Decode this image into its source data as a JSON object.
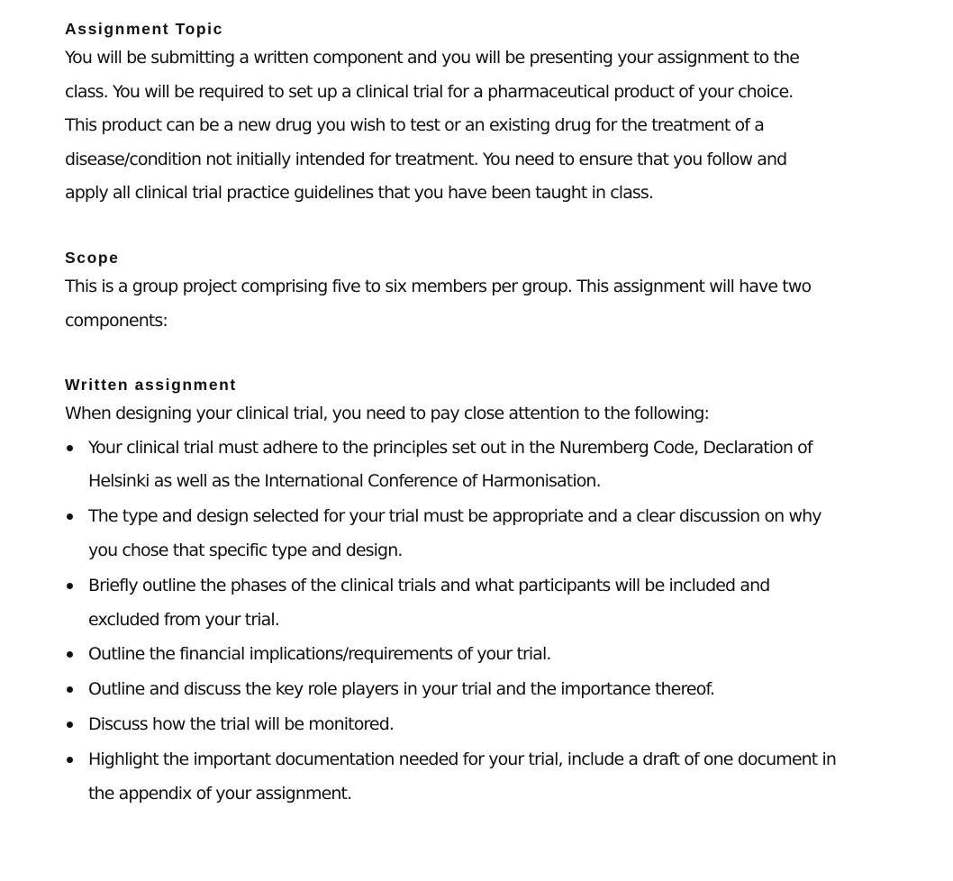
{
  "sections": {
    "topic": {
      "heading": "Assignment Topic",
      "lines": [
        "You will be submitting a written component and you will be presenting your assignment to the",
        "class. You will be required to set up a clinical trial for a pharmaceutical product of your choice.",
        "This product can be a new drug you wish to test or an existing drug for the treatment of a",
        "disease/condition not initially intended for treatment. You need to ensure that you follow and",
        "apply all clinical trial practice guidelines that you have been taught in class."
      ]
    },
    "scope": {
      "heading": "Scope",
      "lines": [
        "This is a group project comprising five to six members per group. This assignment will have two",
        "components:"
      ]
    },
    "written": {
      "heading": "Written assignment",
      "intro": "When designing your clinical trial, you need to pay close attention to the following:",
      "bullets": [
        {
          "lines": [
            "Your clinical trial must adhere to the principles set out in the Nuremberg Code, Declaration of",
            "Helsinki as well as the International Conference of Harmonisation."
          ]
        },
        {
          "lines": [
            "The type and design selected for your trial must be appropriate and a clear discussion on why",
            "you chose that specific type and design."
          ]
        },
        {
          "lines": [
            "Briefly outline the phases of the clinical trials and what participants will be included and",
            "excluded from your trial."
          ]
        },
        {
          "lines": [
            "Outline the financial implications/requirements of your trial."
          ]
        },
        {
          "lines": [
            "Outline and discuss the key role players in your trial and the importance thereof."
          ]
        },
        {
          "lines": [
            "Discuss how the trial will be monitored."
          ]
        },
        {
          "lines": [
            "Highlight the important documentation needed for your trial, include a draft of one document in",
            "the appendix of your assignment."
          ]
        }
      ]
    }
  }
}
